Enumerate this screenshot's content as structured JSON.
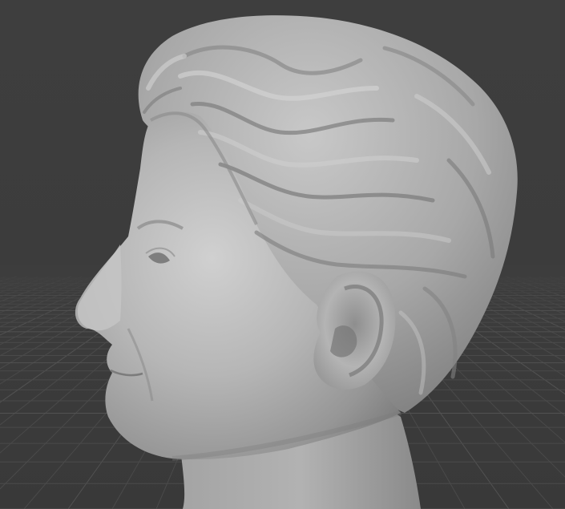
{
  "viewport": {
    "background_color": "#3d3d3d",
    "grid_color": "#4a4a4a",
    "grid_major_color": "#525252",
    "model_base_color": "#9c9c9c",
    "model_highlight_color": "#c4c4c4",
    "model_shadow_color": "#6e6e6e"
  },
  "scene": {
    "object": "sculpted-head-bust",
    "view": "left-profile",
    "shading": "solid-matcap-clay",
    "floor_grid_visible": true
  }
}
